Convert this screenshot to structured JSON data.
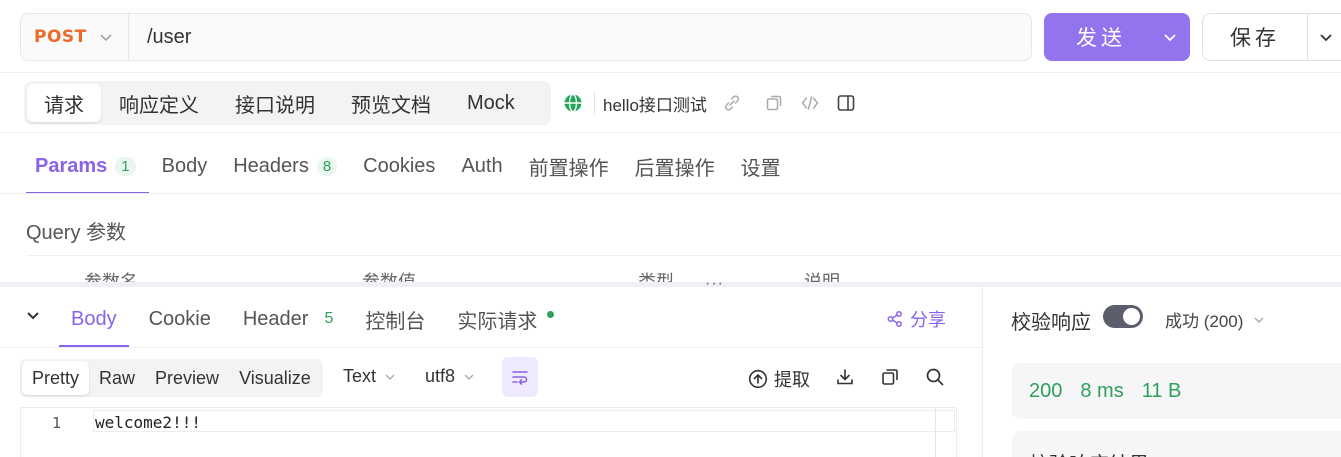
{
  "request": {
    "method": "POST",
    "url": "/user",
    "send_label": "发送",
    "save_label": "保存"
  },
  "doc_tabs": [
    "请求",
    "响应定义",
    "接口说明",
    "预览文档",
    "Mock"
  ],
  "environment": {
    "name": "hello接口测试"
  },
  "request_tabs": [
    {
      "label": "Params",
      "count": "1"
    },
    {
      "label": "Body"
    },
    {
      "label": "Headers",
      "count": "8"
    },
    {
      "label": "Cookies"
    },
    {
      "label": "Auth"
    },
    {
      "label": "前置操作"
    },
    {
      "label": "后置操作"
    },
    {
      "label": "设置"
    }
  ],
  "params": {
    "section_title": "Query 参数",
    "columns": [
      "参数名",
      "参数值",
      "类型",
      "说明"
    ]
  },
  "response": {
    "tabs": [
      {
        "label": "Body"
      },
      {
        "label": "Cookie"
      },
      {
        "label": "Header",
        "count": "5"
      },
      {
        "label": "控制台"
      },
      {
        "label": "实际请求"
      }
    ],
    "share_label": "分享",
    "format_tabs": [
      "Pretty",
      "Raw",
      "Preview",
      "Visualize"
    ],
    "content_type": "Text",
    "encoding": "utf8",
    "extract_label": "提取",
    "line_number": "1",
    "body": "welcome2!!!"
  },
  "validation": {
    "title": "校验响应",
    "status_option": "成功 (200)",
    "status_code": "200",
    "time": "8 ms",
    "size": "11 B",
    "result_title": "校验响应结果"
  },
  "colors": {
    "accent": "#8a64e8",
    "send_button": "#9373ee",
    "method_post": "#ea6a2c",
    "success": "#2ea05b"
  }
}
